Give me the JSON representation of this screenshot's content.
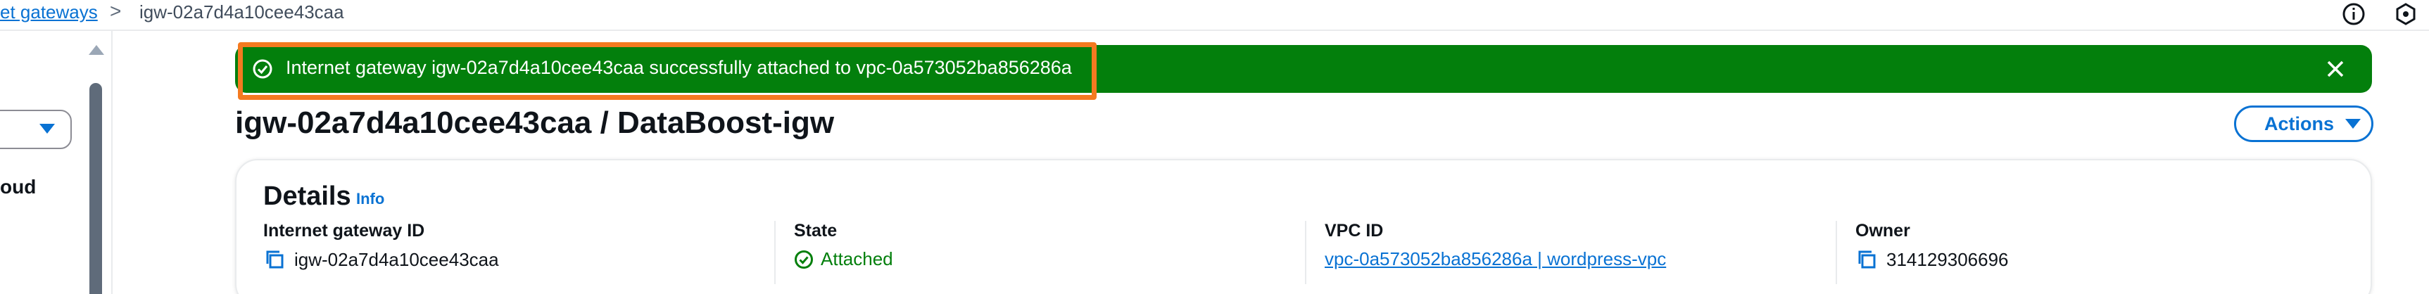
{
  "breadcrumb": {
    "parent_label": "et gateways",
    "separator": ">",
    "current_label": "igw-02a7d4a10cee43caa"
  },
  "top_icons": [
    "info-circle-icon",
    "settings-hex-icon"
  ],
  "left_nav": {
    "partial_text": "oud"
  },
  "flash": {
    "message": "Internet gateway igw-02a7d4a10cee43caa successfully attached to vpc-0a573052ba856286a",
    "type": "success",
    "color": "#037f0c",
    "highlight_color": "#f47a20"
  },
  "page": {
    "title": "igw-02a7d4a10cee43caa / DataBoost-igw",
    "actions_label": "Actions"
  },
  "details": {
    "title": "Details",
    "info_label": "Info",
    "fields": {
      "gateway_id": {
        "label": "Internet gateway ID",
        "value": "igw-02a7d4a10cee43caa"
      },
      "state": {
        "label": "State",
        "value": "Attached"
      },
      "vpc_id": {
        "label": "VPC ID",
        "value": "vpc-0a573052ba856286a | wordpress-vpc"
      },
      "owner": {
        "label": "Owner",
        "value": "314129306696"
      }
    }
  },
  "colors": {
    "link": "#0972d3",
    "success": "#037f0c",
    "text": "#0f141a",
    "border": "#e9ebed"
  }
}
